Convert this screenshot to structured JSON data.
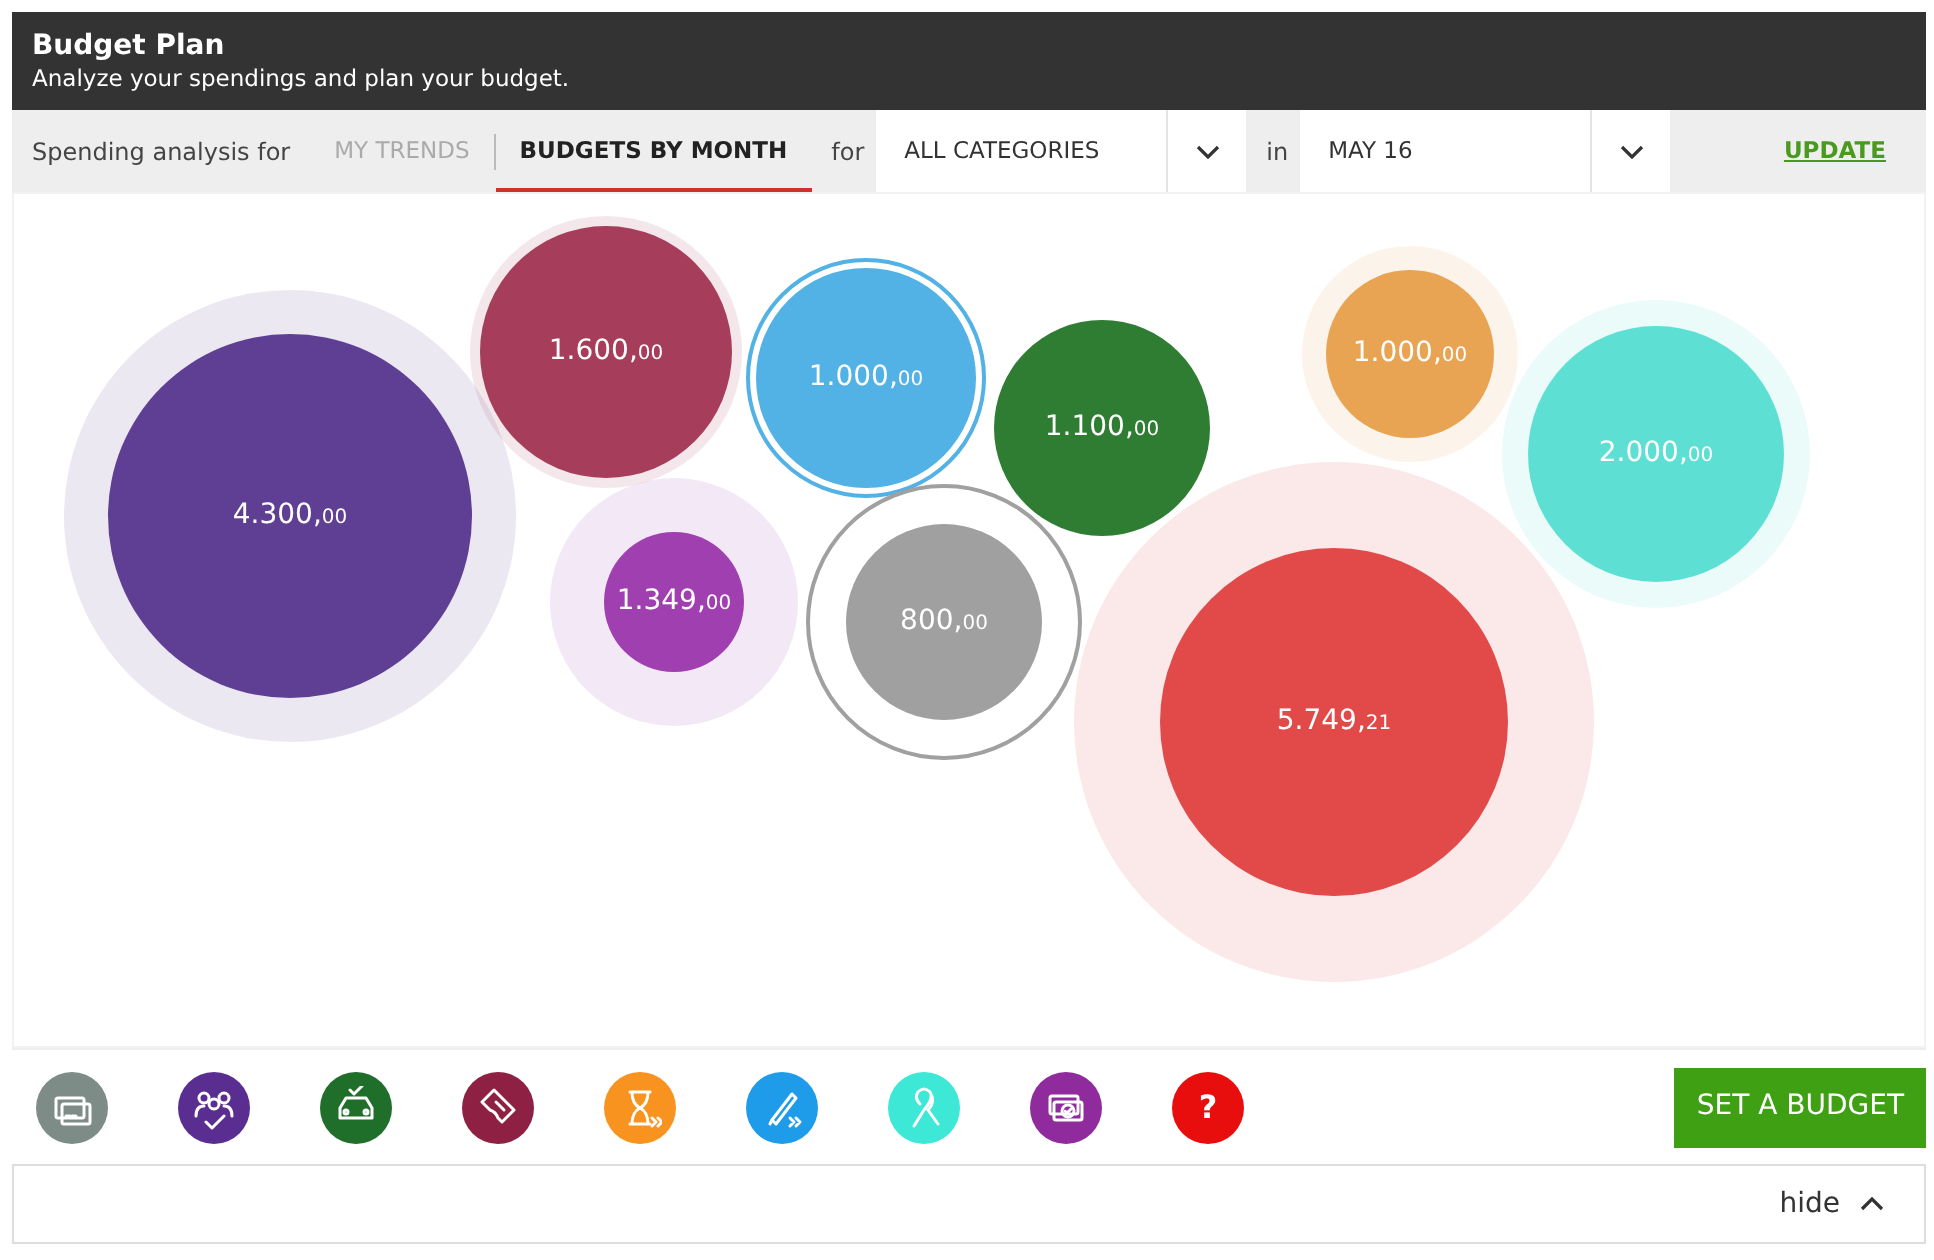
{
  "header": {
    "title": "Budget Plan",
    "subtitle": "Analyze your spendings and plan your budget."
  },
  "filter_bar": {
    "label": "Spending analysis for",
    "tabs": [
      {
        "label": "MY TRENDS",
        "selected": false
      },
      {
        "label": "BUDGETS BY MONTH",
        "selected": true
      }
    ],
    "for_label": "for",
    "category": {
      "value": "ALL CATEGORIES"
    },
    "in_label": "in",
    "month": {
      "value": "MAY 16"
    },
    "update": "UPDATE"
  },
  "bubbles": [
    {
      "amount": "4.300,",
      "cents": "00",
      "color": "#5f3f94",
      "kind": "halo"
    },
    {
      "amount": "1.600,",
      "cents": "00",
      "color": "#a63d5a",
      "kind": "halo"
    },
    {
      "amount": "1.000,",
      "cents": "00",
      "color": "#52b1e5",
      "kind": "ring"
    },
    {
      "amount": "1.100,",
      "cents": "00",
      "color": "#2e7d32",
      "kind": "plain"
    },
    {
      "amount": "1.000,",
      "cents": "00",
      "color": "#e8a453",
      "kind": "halo"
    },
    {
      "amount": "2.000,",
      "cents": "00",
      "color": "#5de0d3",
      "kind": "halo"
    },
    {
      "amount": "1.349,",
      "cents": "00",
      "color": "#a03fb0",
      "kind": "halo"
    },
    {
      "amount": "800,",
      "cents": "00",
      "color": "#a0a0a0",
      "kind": "ring"
    },
    {
      "amount": "5.749,",
      "cents": "21",
      "color": "#e24a4a",
      "kind": "halo"
    }
  ],
  "categories": [
    {
      "kind": "cards",
      "color": "#7d8c87"
    },
    {
      "kind": "family",
      "color": "#5a2e91"
    },
    {
      "kind": "car",
      "color": "#1f6e2a"
    },
    {
      "kind": "ticket",
      "color": "#8e2043"
    },
    {
      "kind": "hourglass",
      "color": "#f7931e"
    },
    {
      "kind": "pen",
      "color": "#1e9be9"
    },
    {
      "kind": "ribbon",
      "color": "#3de8d6"
    },
    {
      "kind": "money",
      "color": "#8f2b9c"
    },
    {
      "kind": "glyph",
      "glyph": "?",
      "color": "#e80e0e"
    }
  ],
  "set_budget": "SET A BUDGET",
  "footer": {
    "toggle": "hide"
  }
}
